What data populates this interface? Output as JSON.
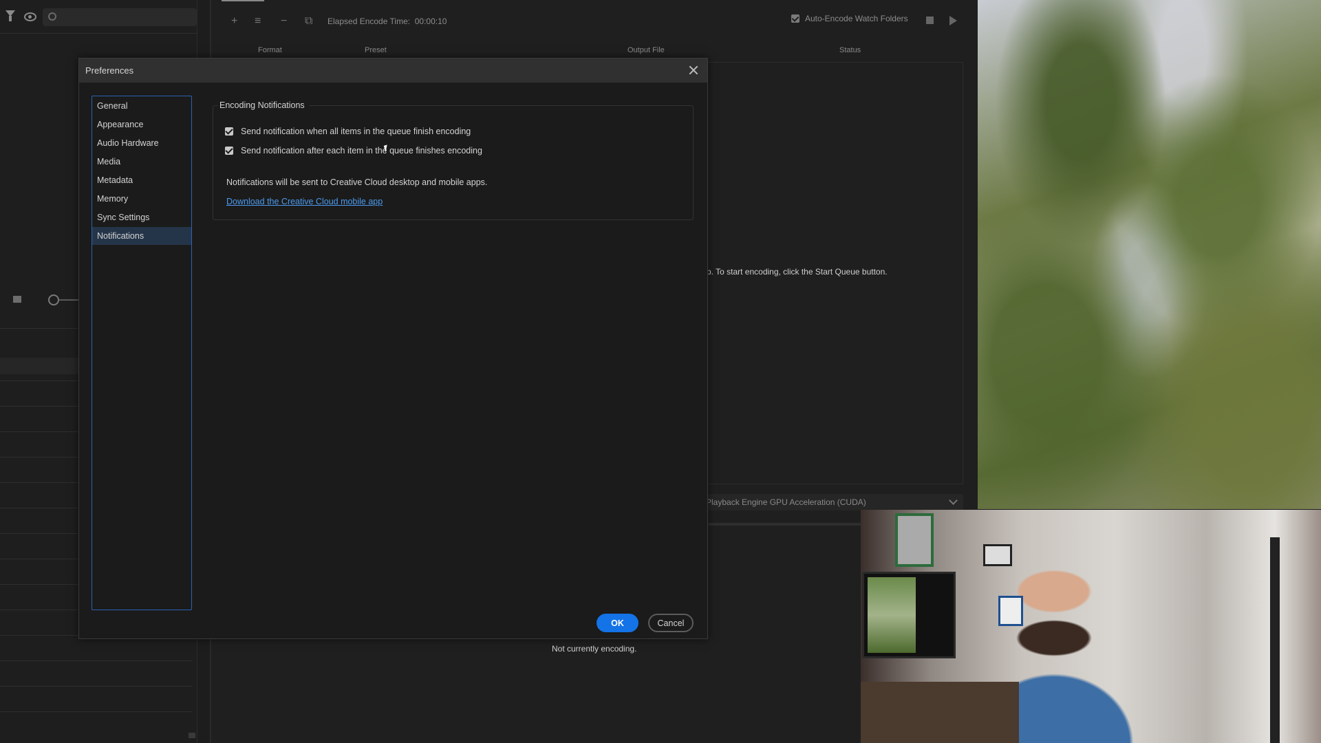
{
  "background_app": {
    "elapsed_label": "Elapsed Encode Time:",
    "elapsed_value": "00:00:10",
    "auto_encode_label": "Auto-Encode Watch Folders",
    "columns": [
      "Format",
      "Preset",
      "Output File",
      "Status"
    ],
    "queue_hint": "p.  To start encoding, click the Start Queue button.",
    "renderer": "Playback Engine GPU Acceleration (CUDA)",
    "status_text": "Not currently encoding."
  },
  "dialog": {
    "title": "Preferences",
    "categories": [
      {
        "label": "General"
      },
      {
        "label": "Appearance"
      },
      {
        "label": "Audio Hardware"
      },
      {
        "label": "Media"
      },
      {
        "label": "Metadata"
      },
      {
        "label": "Memory"
      },
      {
        "label": "Sync Settings"
      },
      {
        "label": "Notifications",
        "selected": true
      }
    ],
    "group_title": "Encoding Notifications",
    "options": [
      {
        "label": "Send notification when all items in the queue finish encoding",
        "checked": true
      },
      {
        "label": "Send notification after each item in the queue finishes encoding",
        "checked": true
      }
    ],
    "info_text": "Notifications will be sent to Creative Cloud desktop and mobile apps.",
    "link_text": "Download the Creative Cloud mobile app",
    "ok_label": "OK",
    "cancel_label": "Cancel"
  },
  "colors": {
    "accent": "#1473e6",
    "link": "#4c9bf0",
    "selected_bg": "#253549"
  },
  "icons": [
    "filter-icon",
    "eye-icon",
    "search-icon",
    "add-icon",
    "settings-icon",
    "remove-icon",
    "duplicate-icon",
    "stop-icon",
    "play-icon",
    "close-icon",
    "chevron-down-icon"
  ]
}
